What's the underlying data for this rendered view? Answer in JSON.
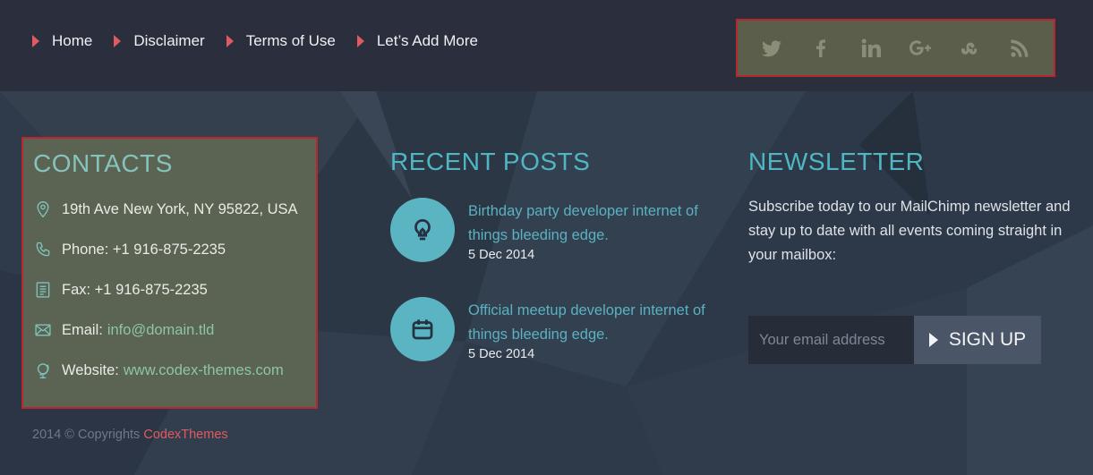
{
  "nav": {
    "items": [
      {
        "label": "Home"
      },
      {
        "label": "Disclaimer"
      },
      {
        "label": "Terms of Use"
      },
      {
        "label": "Let’s Add More"
      }
    ]
  },
  "social": {
    "icons": [
      "twitter-icon",
      "facebook-icon",
      "linkedin-icon",
      "google-plus-icon",
      "stumbleupon-icon",
      "rss-icon"
    ]
  },
  "contacts": {
    "title": "CONTACTS",
    "address": "19th Ave New York, NY 95822, USA",
    "phone": "Phone: +1 916-875-2235",
    "fax": "Fax: +1 916-875-2235",
    "email_label": "Email:",
    "email": "info@domain.tld",
    "website_label": "Website:",
    "website": "www.codex-themes.com"
  },
  "recent": {
    "title": "RECENT POSTS",
    "posts": [
      {
        "title": "Birthday party developer internet of things bleeding edge.",
        "date": "5 Dec 2014",
        "icon": "lightbulb-icon"
      },
      {
        "title": "Official meetup developer internet of things bleeding edge.",
        "date": "5 Dec 2014",
        "icon": "calendar-icon"
      }
    ]
  },
  "newsletter": {
    "title": "NEWSLETTER",
    "text": "Subscribe today to our MailChimp newsletter and stay up to date with all events coming straight in your mailbox:",
    "placeholder": "Your email address",
    "button": "SIGN UP"
  },
  "footer": {
    "copyright": "2014 © Copyrights",
    "brand": "CodexThemes"
  },
  "colors": {
    "accent": "#e05a5f",
    "title": "#4fb7c4",
    "topbar": "#2b2f3d",
    "body": "#2f3b4a"
  }
}
